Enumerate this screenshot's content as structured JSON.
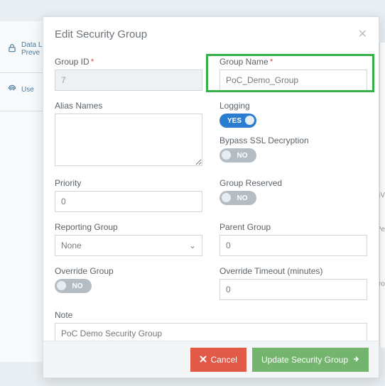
{
  "background": {
    "tile1": "Data L",
    "tile1b": "Preve",
    "tile2": "Use",
    "side_r1": "nV",
    "side_r2": "Pe",
    "side_r3": "ro"
  },
  "modal": {
    "title": "Edit Security Group",
    "labels": {
      "group_id": "Group ID",
      "group_name": "Group Name",
      "alias": "Alias Names",
      "logging": "Logging",
      "bypass": "Bypass SSL Decryption",
      "priority": "Priority",
      "group_reserved": "Group Reserved",
      "reporting": "Reporting Group",
      "parent": "Parent Group",
      "override_group": "Override Group",
      "override_timeout": "Override Timeout (minutes)",
      "note": "Note"
    },
    "values": {
      "group_id": "7",
      "group_name": "PoC_Demo_Group",
      "alias": "",
      "priority": "0",
      "reporting": "None",
      "parent": "0",
      "override_timeout": "0",
      "note": "PoC Demo Security Group"
    },
    "toggles": {
      "yes": "YES",
      "no": "NO"
    },
    "buttons": {
      "cancel": "Cancel",
      "update": "Update Security Group"
    }
  }
}
